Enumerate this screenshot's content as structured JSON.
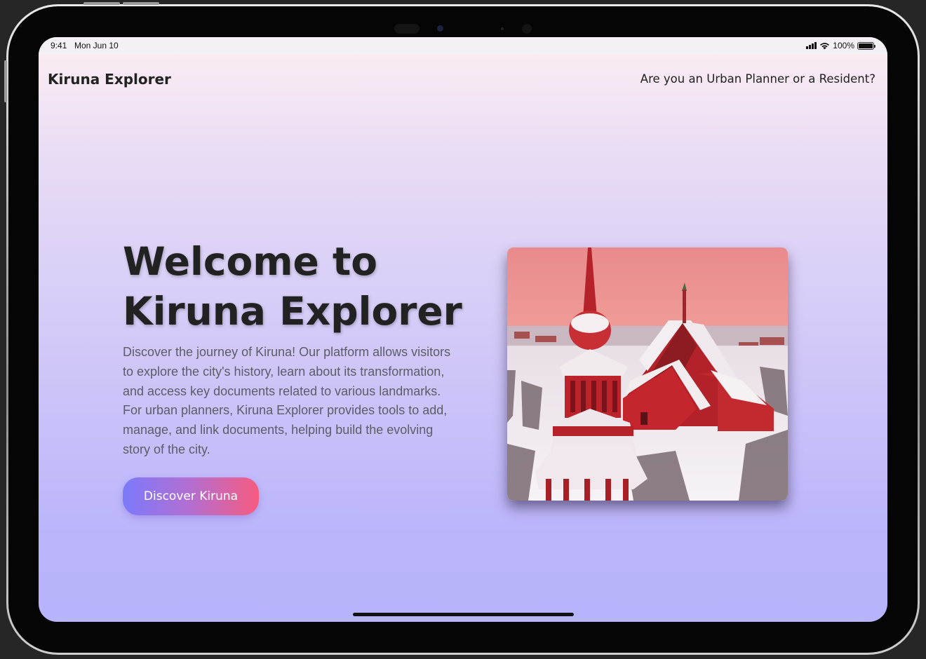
{
  "status_bar": {
    "time": "9:41",
    "date": "Mon Jun 10",
    "battery_percent": "100%",
    "icons": [
      "signal-icon",
      "wifi-icon",
      "battery-icon"
    ]
  },
  "header": {
    "brand": "Kiruna Explorer",
    "role_prompt": "Are you an Urban Planner or a Resident?"
  },
  "hero": {
    "title_line1": "Welcome to",
    "title_line2": "Kiruna Explorer",
    "description": "Discover the journey of Kiruna! Our platform allows visitors to explore the city's history, learn about its transformation, and access key documents related to various landmarks. For urban planners, Kiruna Explorer provides tools to add, manage, and link documents, helping build the evolving story of the city.",
    "cta_label": "Discover Kiruna"
  },
  "colors": {
    "cta_gradient_start": "#7b7afb",
    "cta_gradient_end": "#f65b7f",
    "background_top": "#fdeef2",
    "background_bottom": "#b7b3fc",
    "text_dark": "#222222"
  }
}
